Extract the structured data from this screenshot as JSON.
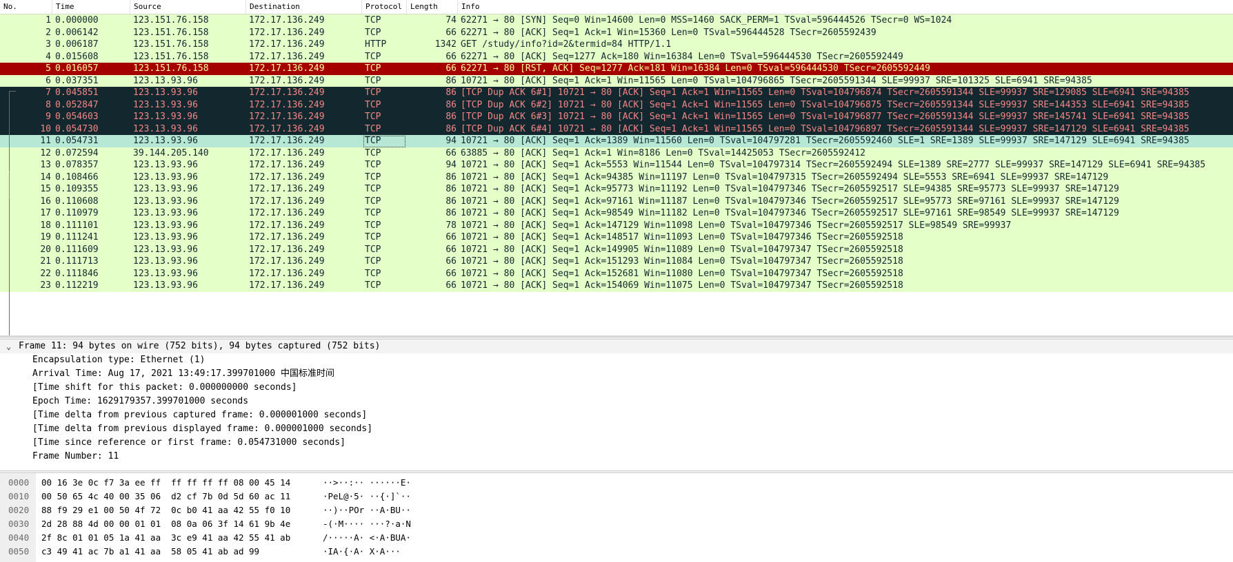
{
  "columns": [
    "No.",
    "Time",
    "Source",
    "Destination",
    "Protocol",
    "Length",
    "Info"
  ],
  "colors": {
    "tcp": "#e4ffc7",
    "rst_bg": "#a40000",
    "rst_fg": "#fffc9c",
    "dup_bg": "#12272e",
    "dup_fg": "#f78787",
    "selected": "#b7e8d5"
  },
  "packets": [
    {
      "no": "1",
      "time": "0.000000",
      "src": "123.151.76.158",
      "dst": "172.17.136.249",
      "proto": "TCP",
      "len": "74",
      "info": "62271 → 80 [SYN] Seq=0 Win=14600 Len=0 MSS=1460 SACK_PERM=1 TSval=596444526 TSecr=0 WS=1024",
      "style": "tcp"
    },
    {
      "no": "2",
      "time": "0.006142",
      "src": "123.151.76.158",
      "dst": "172.17.136.249",
      "proto": "TCP",
      "len": "66",
      "info": "62271 → 80 [ACK] Seq=1 Ack=1 Win=15360 Len=0 TSval=596444528 TSecr=2605592439",
      "style": "tcp"
    },
    {
      "no": "3",
      "time": "0.006187",
      "src": "123.151.76.158",
      "dst": "172.17.136.249",
      "proto": "HTTP",
      "len": "1342",
      "info": "GET /study/info?id=2&termid=84 HTTP/1.1",
      "style": "http"
    },
    {
      "no": "4",
      "time": "0.015608",
      "src": "123.151.76.158",
      "dst": "172.17.136.249",
      "proto": "TCP",
      "len": "66",
      "info": "62271 → 80 [ACK] Seq=1277 Ack=180 Win=16384 Len=0 TSval=596444530 TSecr=2605592449",
      "style": "tcp"
    },
    {
      "no": "5",
      "time": "0.016057",
      "src": "123.151.76.158",
      "dst": "172.17.136.249",
      "proto": "TCP",
      "len": "66",
      "info": "62271 → 80 [RST, ACK] Seq=1277 Ack=181 Win=16384 Len=0 TSval=596444530 TSecr=2605592449",
      "style": "rst"
    },
    {
      "no": "6",
      "time": "0.037351",
      "src": "123.13.93.96",
      "dst": "172.17.136.249",
      "proto": "TCP",
      "len": "86",
      "info": "10721 → 80 [ACK] Seq=1 Ack=1 Win=11565 Len=0 TSval=104796865 TSecr=2605591344 SLE=99937 SRE=101325 SLE=6941 SRE=94385",
      "style": "tcp"
    },
    {
      "no": "7",
      "time": "0.045851",
      "src": "123.13.93.96",
      "dst": "172.17.136.249",
      "proto": "TCP",
      "len": "86",
      "info": "[TCP Dup ACK 6#1] 10721 → 80 [ACK] Seq=1 Ack=1 Win=11565 Len=0 TSval=104796874 TSecr=2605591344 SLE=99937 SRE=129085 SLE=6941 SRE=94385",
      "style": "dup"
    },
    {
      "no": "8",
      "time": "0.052847",
      "src": "123.13.93.96",
      "dst": "172.17.136.249",
      "proto": "TCP",
      "len": "86",
      "info": "[TCP Dup ACK 6#2] 10721 → 80 [ACK] Seq=1 Ack=1 Win=11565 Len=0 TSval=104796875 TSecr=2605591344 SLE=99937 SRE=144353 SLE=6941 SRE=94385",
      "style": "dup"
    },
    {
      "no": "9",
      "time": "0.054603",
      "src": "123.13.93.96",
      "dst": "172.17.136.249",
      "proto": "TCP",
      "len": "86",
      "info": "[TCP Dup ACK 6#3] 10721 → 80 [ACK] Seq=1 Ack=1 Win=11565 Len=0 TSval=104796877 TSecr=2605591344 SLE=99937 SRE=145741 SLE=6941 SRE=94385",
      "style": "dup"
    },
    {
      "no": "10",
      "time": "0.054730",
      "src": "123.13.93.96",
      "dst": "172.17.136.249",
      "proto": "TCP",
      "len": "86",
      "info": "[TCP Dup ACK 6#4] 10721 → 80 [ACK] Seq=1 Ack=1 Win=11565 Len=0 TSval=104796897 TSecr=2605591344 SLE=99937 SRE=147129 SLE=6941 SRE=94385",
      "style": "dup"
    },
    {
      "no": "11",
      "time": "0.054731",
      "src": "123.13.93.96",
      "dst": "172.17.136.249",
      "proto": "TCP",
      "len": "94",
      "info": "10721 → 80 [ACK] Seq=1 Ack=1389 Win=11560 Len=0 TSval=104797281 TSecr=2605592460 SLE=1 SRE=1389 SLE=99937 SRE=147129 SLE=6941 SRE=94385",
      "style": "sel"
    },
    {
      "no": "12",
      "time": "0.072594",
      "src": "39.144.205.140",
      "dst": "172.17.136.249",
      "proto": "TCP",
      "len": "66",
      "info": "63885 → 80 [ACK] Seq=1 Ack=1 Win=8186 Len=0 TSval=14425053 TSecr=2605592412",
      "style": "tcp"
    },
    {
      "no": "13",
      "time": "0.078357",
      "src": "123.13.93.96",
      "dst": "172.17.136.249",
      "proto": "TCP",
      "len": "94",
      "info": "10721 → 80 [ACK] Seq=1 Ack=5553 Win=11544 Len=0 TSval=104797314 TSecr=2605592494 SLE=1389 SRE=2777 SLE=99937 SRE=147129 SLE=6941 SRE=94385",
      "style": "tcp"
    },
    {
      "no": "14",
      "time": "0.108466",
      "src": "123.13.93.96",
      "dst": "172.17.136.249",
      "proto": "TCP",
      "len": "86",
      "info": "10721 → 80 [ACK] Seq=1 Ack=94385 Win=11197 Len=0 TSval=104797315 TSecr=2605592494 SLE=5553 SRE=6941 SLE=99937 SRE=147129",
      "style": "tcp"
    },
    {
      "no": "15",
      "time": "0.109355",
      "src": "123.13.93.96",
      "dst": "172.17.136.249",
      "proto": "TCP",
      "len": "86",
      "info": "10721 → 80 [ACK] Seq=1 Ack=95773 Win=11192 Len=0 TSval=104797346 TSecr=2605592517 SLE=94385 SRE=95773 SLE=99937 SRE=147129",
      "style": "tcp"
    },
    {
      "no": "16",
      "time": "0.110608",
      "src": "123.13.93.96",
      "dst": "172.17.136.249",
      "proto": "TCP",
      "len": "86",
      "info": "10721 → 80 [ACK] Seq=1 Ack=97161 Win=11187 Len=0 TSval=104797346 TSecr=2605592517 SLE=95773 SRE=97161 SLE=99937 SRE=147129",
      "style": "tcp"
    },
    {
      "no": "17",
      "time": "0.110979",
      "src": "123.13.93.96",
      "dst": "172.17.136.249",
      "proto": "TCP",
      "len": "86",
      "info": "10721 → 80 [ACK] Seq=1 Ack=98549 Win=11182 Len=0 TSval=104797346 TSecr=2605592517 SLE=97161 SRE=98549 SLE=99937 SRE=147129",
      "style": "tcp"
    },
    {
      "no": "18",
      "time": "0.111101",
      "src": "123.13.93.96",
      "dst": "172.17.136.249",
      "proto": "TCP",
      "len": "78",
      "info": "10721 → 80 [ACK] Seq=1 Ack=147129 Win=11098 Len=0 TSval=104797346 TSecr=2605592517 SLE=98549 SRE=99937",
      "style": "tcp"
    },
    {
      "no": "19",
      "time": "0.111241",
      "src": "123.13.93.96",
      "dst": "172.17.136.249",
      "proto": "TCP",
      "len": "66",
      "info": "10721 → 80 [ACK] Seq=1 Ack=148517 Win=11093 Len=0 TSval=104797346 TSecr=2605592518",
      "style": "tcp"
    },
    {
      "no": "20",
      "time": "0.111609",
      "src": "123.13.93.96",
      "dst": "172.17.136.249",
      "proto": "TCP",
      "len": "66",
      "info": "10721 → 80 [ACK] Seq=1 Ack=149905 Win=11089 Len=0 TSval=104797347 TSecr=2605592518",
      "style": "tcp"
    },
    {
      "no": "21",
      "time": "0.111713",
      "src": "123.13.93.96",
      "dst": "172.17.136.249",
      "proto": "TCP",
      "len": "66",
      "info": "10721 → 80 [ACK] Seq=1 Ack=151293 Win=11084 Len=0 TSval=104797347 TSecr=2605592518",
      "style": "tcp"
    },
    {
      "no": "22",
      "time": "0.111846",
      "src": "123.13.93.96",
      "dst": "172.17.136.249",
      "proto": "TCP",
      "len": "66",
      "info": "10721 → 80 [ACK] Seq=1 Ack=152681 Win=11080 Len=0 TSval=104797347 TSecr=2605592518",
      "style": "tcp"
    },
    {
      "no": "23",
      "time": "0.112219",
      "src": "123.13.93.96",
      "dst": "172.17.136.249",
      "proto": "TCP",
      "len": "66",
      "info": "10721 → 80 [ACK] Seq=1 Ack=154069 Win=11075 Len=0 TSval=104797347 TSecr=2605592518",
      "style": "tcp"
    }
  ],
  "details": {
    "frame_summary": "Frame 11: 94 bytes on wire (752 bits), 94 bytes captured (752 bits)",
    "lines": [
      "Encapsulation type: Ethernet (1)",
      "Arrival Time: Aug 17, 2021 13:49:17.399701000 中国标准时间",
      "[Time shift for this packet: 0.000000000 seconds]",
      "Epoch Time: 1629179357.399701000 seconds",
      "[Time delta from previous captured frame: 0.000001000 seconds]",
      "[Time delta from previous displayed frame: 0.000001000 seconds]",
      "[Time since reference or first frame: 0.054731000 seconds]",
      "Frame Number: 11"
    ]
  },
  "bytes": [
    {
      "offset": "0000",
      "hex": "00 16 3e 0c f7 3a ee ff  ff ff ff ff 08 00 45 14",
      "ascii": "··>··:·· ······E·"
    },
    {
      "offset": "0010",
      "hex": "00 50 65 4c 40 00 35 06  d2 cf 7b 0d 5d 60 ac 11",
      "ascii": "·PeL@·5· ··{·]`··"
    },
    {
      "offset": "0020",
      "hex": "88 f9 29 e1 00 50 4f 72  0c b0 41 aa 42 55 f0 10",
      "ascii": "··)··POr ··A·BU··"
    },
    {
      "offset": "0030",
      "hex": "2d 28 88 4d 00 00 01 01  08 0a 06 3f 14 61 9b 4e",
      "ascii": "-(·M···· ···?·a·N"
    },
    {
      "offset": "0040",
      "hex": "2f 8c 01 01 05 1a 41 aa  3c e9 41 aa 42 55 41 ab",
      "ascii": "/·····A· <·A·BUA·"
    },
    {
      "offset": "0050",
      "hex": "c3 49 41 ac 7b a1 41 aa  58 05 41 ab ad 99",
      "ascii": "·IA·{·A· X·A···"
    }
  ]
}
